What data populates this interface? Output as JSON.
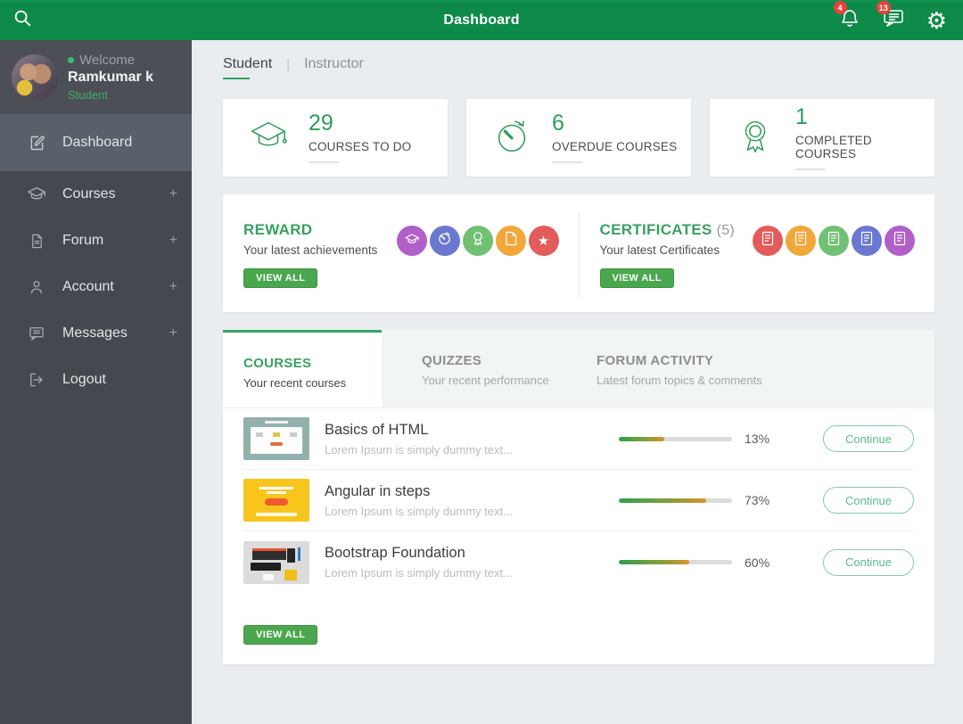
{
  "colors": {
    "header_green": "#0d8a48",
    "accent_green": "#2f9c5c",
    "button_green": "#4aa74e",
    "badge_red": "#e8423c",
    "sidebar_dark": "#45484e",
    "sidebar_active": "#596069",
    "progress_start": "#2f9e4f",
    "progress_end": "#d9932e"
  },
  "header": {
    "title": "Dashboard",
    "notifications_badge": "4",
    "messages_badge": "13",
    "icons": [
      "search-icon",
      "bell-icon",
      "chat-icon",
      "gear-icon"
    ]
  },
  "sidebar": {
    "welcome": "Welcome",
    "user_name": "Ramkumar k",
    "user_role": "Student",
    "items": [
      {
        "label": "Dashboard",
        "icon": "dashboard-icon",
        "active": true
      },
      {
        "label": "Courses",
        "icon": "graduation-cap-icon",
        "expand": "+"
      },
      {
        "label": "Forum",
        "icon": "document-icon",
        "expand": "+"
      },
      {
        "label": "Account",
        "icon": "user-icon",
        "expand": "+"
      },
      {
        "label": "Messages",
        "icon": "chat-icon",
        "expand": "+"
      },
      {
        "label": "Logout",
        "icon": "logout-icon"
      }
    ]
  },
  "main": {
    "view_tabs": [
      {
        "label": "Student",
        "active": true
      },
      {
        "label": "Instructor",
        "active": false
      }
    ],
    "view_tabs_separator": "|",
    "stats": [
      {
        "value": "29",
        "label": "COURSES TO DO",
        "icon": "graduation-cap-icon"
      },
      {
        "value": "6",
        "label": "OVERDUE COURSES",
        "icon": "clock-icon"
      },
      {
        "value": "1",
        "label": "COMPLETED COURSES",
        "icon": "award-icon"
      }
    ],
    "reward": {
      "title": "REWARD",
      "subtitle": "Your latest achievements",
      "view_all_label": "VIEW ALL",
      "badges": [
        {
          "icon": "graduation-cap-icon",
          "color": "#b15fc9"
        },
        {
          "icon": "clock-icon",
          "color": "#6a78d1"
        },
        {
          "icon": "award-icon",
          "color": "#71c175"
        },
        {
          "icon": "document-icon",
          "color": "#f2a73b"
        },
        {
          "icon": "star-icon",
          "color": "#e25c5c",
          "glyph": "★"
        }
      ]
    },
    "certificates": {
      "title": "CERTIFICATES",
      "count": "(5)",
      "subtitle": "Your latest Certificates",
      "view_all_label": "VIEW ALL",
      "badges": [
        {
          "icon": "certificate-icon",
          "color": "#e25c5c"
        },
        {
          "icon": "certificate-icon",
          "color": "#f2a73b"
        },
        {
          "icon": "certificate-icon",
          "color": "#71c175"
        },
        {
          "icon": "certificate-icon",
          "color": "#6a78d1"
        },
        {
          "icon": "certificate-icon",
          "color": "#b15fc9"
        }
      ]
    },
    "content_tabs": [
      {
        "label": "COURSES",
        "subtitle": "Your recent courses",
        "active": true
      },
      {
        "label": "QUIZZES",
        "subtitle": "Your recent performance",
        "active": false
      },
      {
        "label": "FORUM ACTIVITY",
        "subtitle": "Latest forum topics & comments",
        "active": false
      }
    ],
    "courses": [
      {
        "title": "Basics of HTML",
        "description": "Lorem Ipsum is simply dummy text...",
        "progress_label": "13%",
        "fill_pct": 40,
        "button_label": "Continue"
      },
      {
        "title": "Angular in steps",
        "description": "Lorem Ipsum is simply dummy text...",
        "progress_label": "73%",
        "fill_pct": 77,
        "button_label": "Continue"
      },
      {
        "title": "Bootstrap Foundation",
        "description": "Lorem Ipsum is simply dummy text...",
        "progress_label": "60%",
        "fill_pct": 62,
        "button_label": "Continue"
      }
    ],
    "view_all_label": "VIEW ALL"
  }
}
